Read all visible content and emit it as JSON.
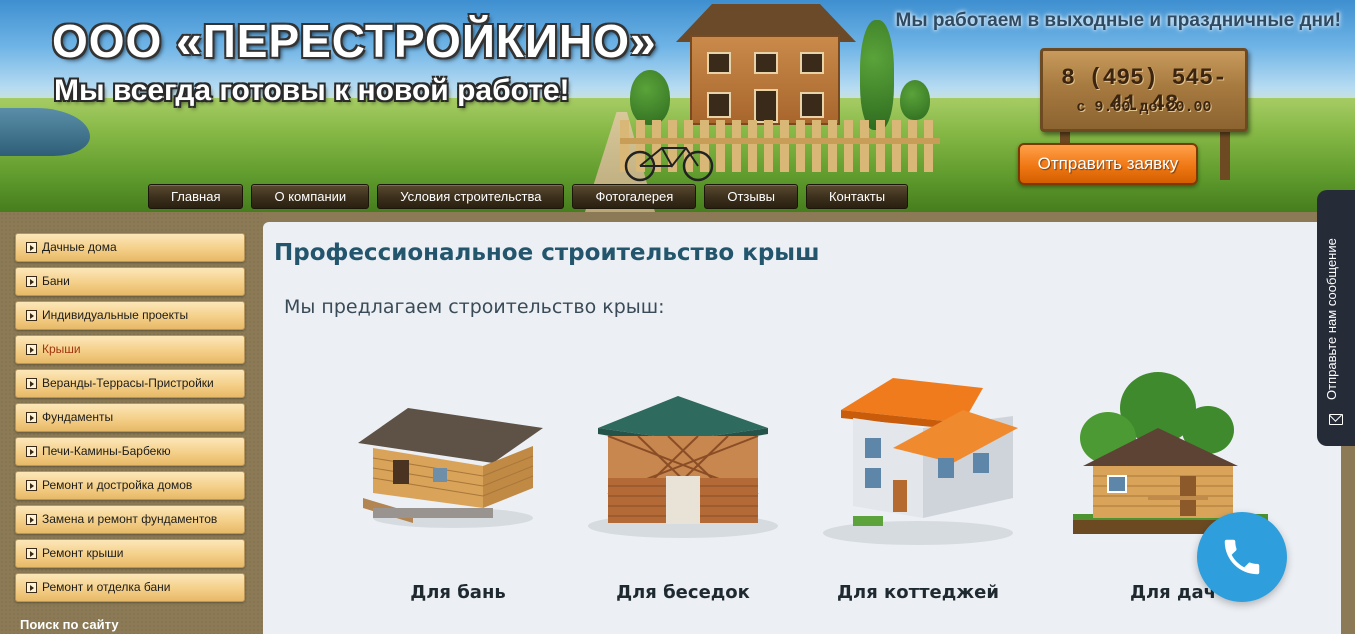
{
  "header": {
    "brand_title": "ООО «ПЕРЕСТРОЙКИНО»",
    "tagline": "Мы всегда готовы к новой работе!",
    "work_note": "Мы работаем в выходные и праздничные дни!",
    "sign": {
      "phone": "8 (495) 545-41-48",
      "hours": "с 9.00 до 20.00"
    },
    "request_button": "Отправить заявку"
  },
  "nav": {
    "items": [
      {
        "label": "Главная"
      },
      {
        "label": "О компании"
      },
      {
        "label": "Условия строительства"
      },
      {
        "label": "Фотогалерея"
      },
      {
        "label": "Отзывы"
      },
      {
        "label": "Контакты"
      }
    ]
  },
  "sidebar": {
    "items": [
      {
        "label": "Дачные дома"
      },
      {
        "label": "Бани"
      },
      {
        "label": "Индивидуальные проекты"
      },
      {
        "label": "Крыши",
        "active": true
      },
      {
        "label": "Веранды-Террасы-Пристройки"
      },
      {
        "label": "Фундаменты"
      },
      {
        "label": "Печи-Камины-Барбекю"
      },
      {
        "label": "Ремонт и достройка домов"
      },
      {
        "label": "Замена и ремонт фундаментов"
      },
      {
        "label": "Ремонт крыши"
      },
      {
        "label": "Ремонт и отделка бани"
      }
    ],
    "search_title": "Поиск по сайту"
  },
  "content": {
    "title": "Профессиональное строительство крыш",
    "lead": "Мы предлагаем строительство крыш:",
    "cards": [
      {
        "label": "Для бань",
        "icon": "bathhouse-image"
      },
      {
        "label": "Для беседок",
        "icon": "gazebo-image"
      },
      {
        "label": "Для коттеджей",
        "icon": "cottage-image"
      },
      {
        "label": "Для дач",
        "icon": "dacha-image"
      }
    ]
  },
  "widgets": {
    "message_tab": "Отправьте нам сообщение",
    "call_button_icon": "phone-icon"
  },
  "colors": {
    "title_blue": "#23556d",
    "accent_orange": "#f07814",
    "call_blue": "#2e9fdc",
    "sidebar_bg": "#8b7a55"
  }
}
